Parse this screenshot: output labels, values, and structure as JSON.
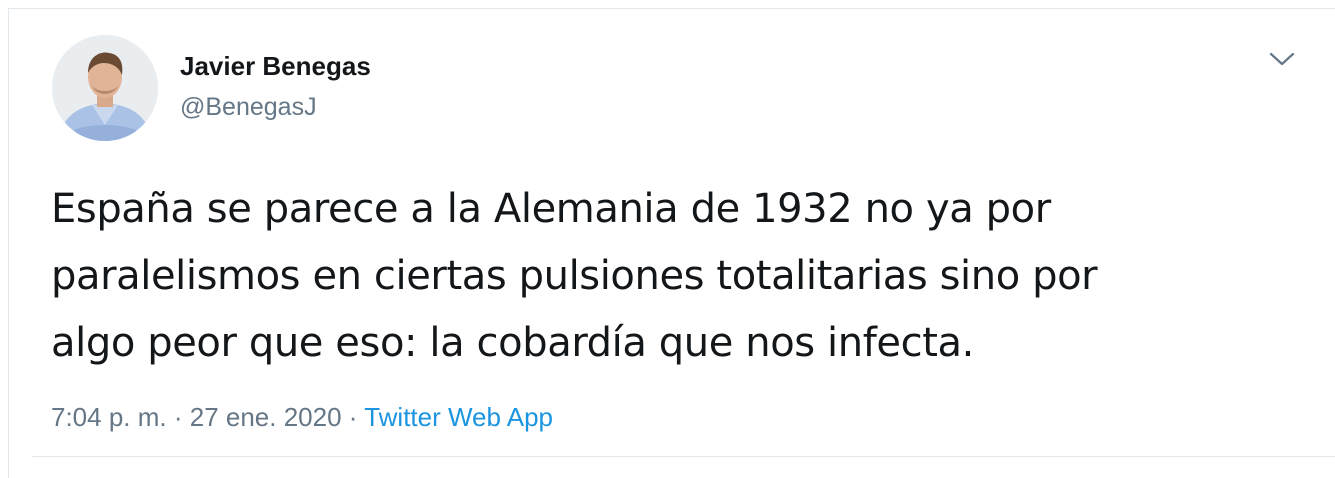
{
  "author": {
    "name": "Javier Benegas",
    "handle": "@BenegasJ"
  },
  "tweet": {
    "lines": [
      "España se parece a la Alemania de 1932 no ya por",
      "paralelismos en ciertas pulsiones totalitarias sino por",
      "algo peor que eso: la cobardía que nos infecta."
    ]
  },
  "meta": {
    "time": "7:04 p. m.",
    "separator": " · ",
    "date": "27 ene. 2020",
    "source": "Twitter Web App"
  },
  "icons": {
    "menu": "chevron-down-icon",
    "avatar": "profile-photo"
  },
  "colors": {
    "text": "#14171a",
    "secondary": "#657786",
    "link": "#1b95e0",
    "border": "#e1e8ed"
  }
}
